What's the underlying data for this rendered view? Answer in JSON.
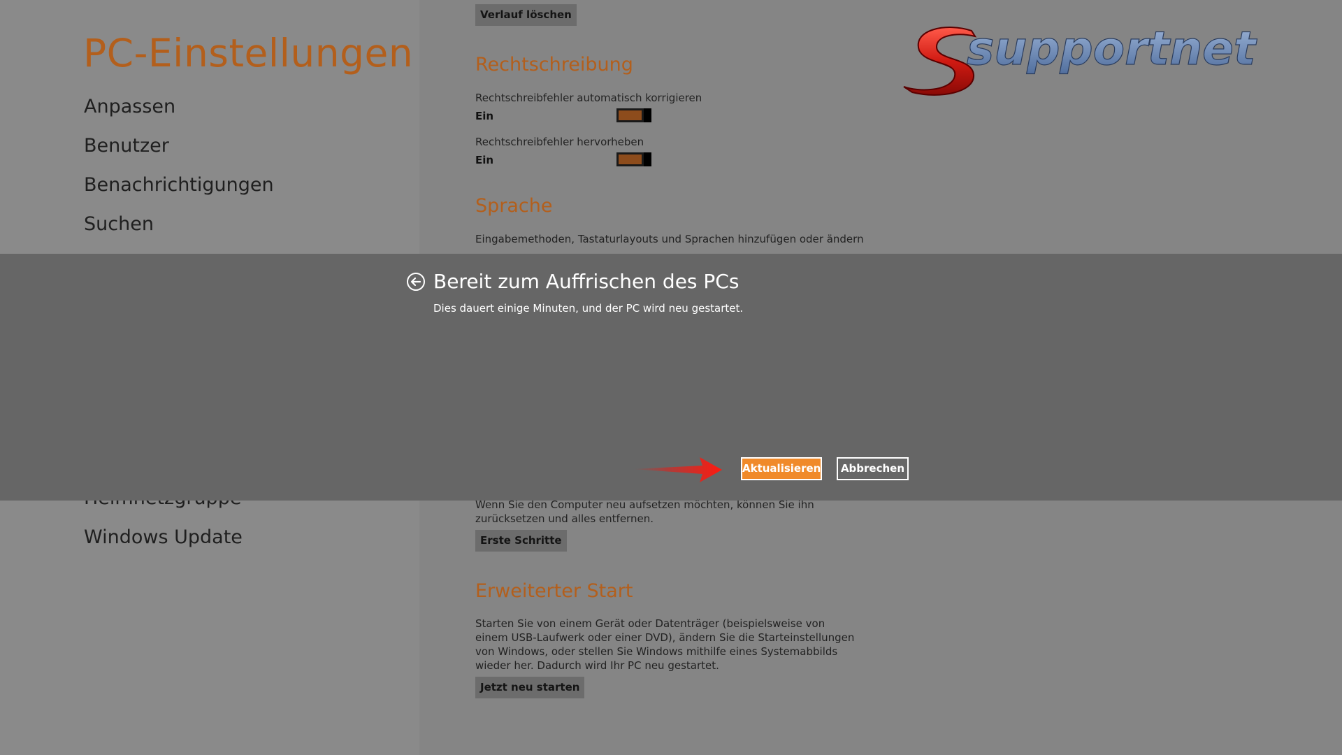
{
  "sidebar": {
    "title": "PC-Einstellungen",
    "items": [
      {
        "label": "Anpassen"
      },
      {
        "label": "Benutzer"
      },
      {
        "label": "Benachrichtigungen"
      },
      {
        "label": "Suchen"
      },
      {
        "label": "Heimnetzgruppe"
      },
      {
        "label": "Windows Update"
      }
    ]
  },
  "main": {
    "clear_history_button": "Verlauf löschen",
    "spelling": {
      "heading": "Rechtschreibung",
      "autocorrect_label": "Rechtschreibfehler automatisch korrigieren",
      "autocorrect_state": "Ein",
      "highlight_label": "Rechtschreibfehler hervorheben",
      "highlight_state": "Ein"
    },
    "language": {
      "heading": "Sprache",
      "link_text": "Eingabemethoden, Tastaturlayouts und Sprachen hinzufügen oder ändern"
    },
    "reset": {
      "text": "Wenn Sie den Computer neu aufsetzen möchten, können Sie ihn zurücksetzen und alles entfernen.",
      "button": "Erste Schritte"
    },
    "advanced_start": {
      "heading": "Erweiterter Start",
      "text": "Starten Sie von einem Gerät oder Datenträger (beispielsweise von einem USB-Laufwerk oder einer DVD), ändern Sie die Starteinstellungen von Windows, oder stellen Sie Windows mithilfe eines Systemabbilds wieder her. Dadurch wird Ihr PC neu gestartet.",
      "button": "Jetzt neu starten"
    }
  },
  "dialog": {
    "title": "Bereit zum Auffrischen des PCs",
    "subtitle": "Dies dauert einige Minuten, und der PC wird neu gestartet.",
    "primary_button": "Aktualisieren",
    "secondary_button": "Abbrechen"
  },
  "watermark": {
    "text": "supportnet"
  },
  "colors": {
    "accent": "#b35f1c",
    "primary_button": "#f08a2a",
    "overlay": "#666666",
    "arrow": "#e0201a"
  },
  "icons": {
    "dialog_back": "back-arrow-circle-icon",
    "pointer": "red-arrow-icon"
  }
}
